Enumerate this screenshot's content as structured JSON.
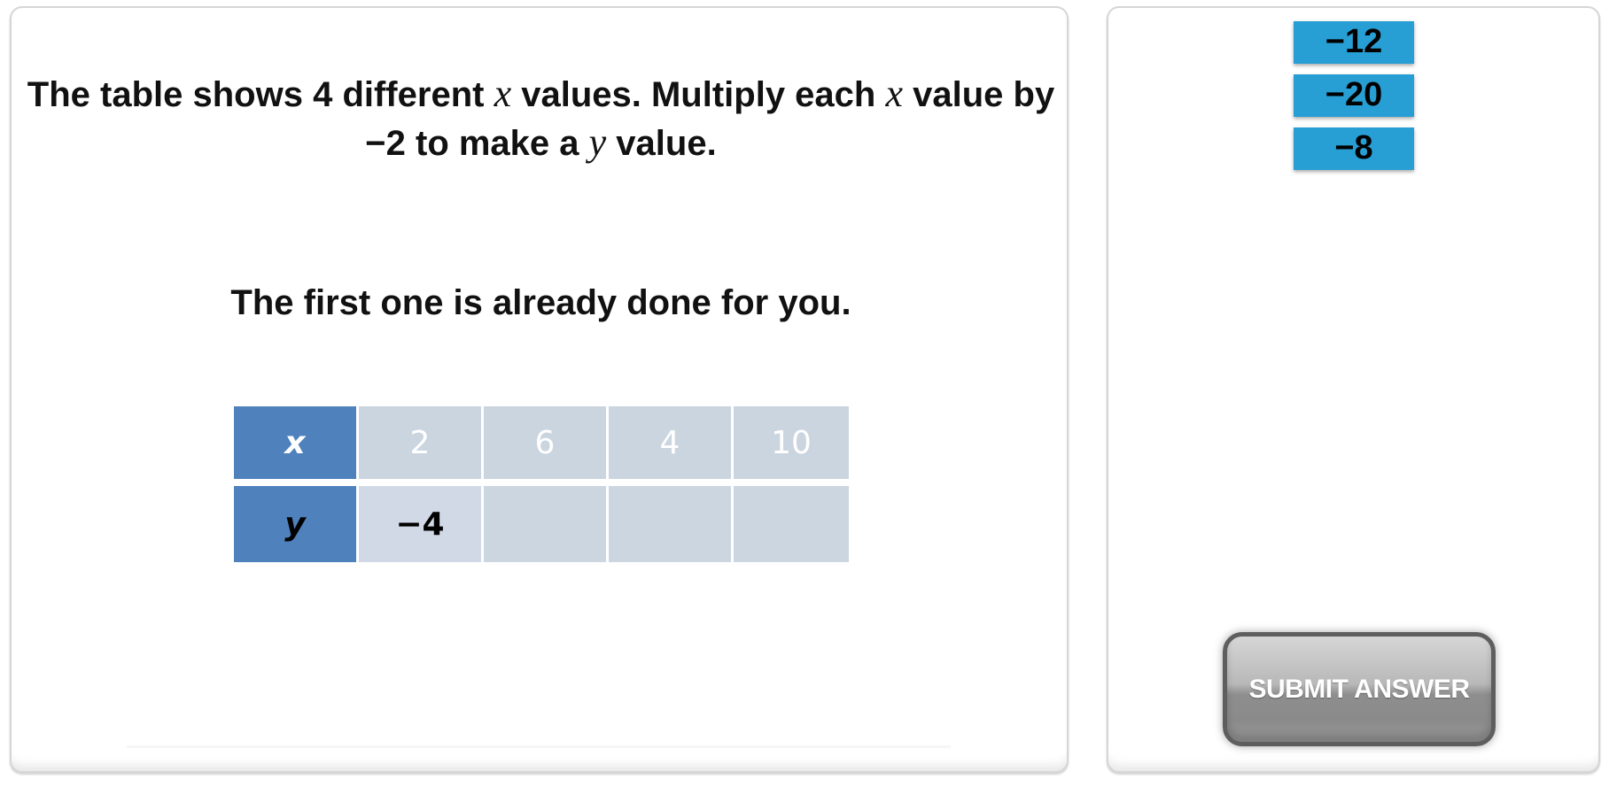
{
  "question": {
    "paragraph1": {
      "part1": "The table shows 4 different ",
      "var1": "x",
      "part2": " values. Multiply each ",
      "var2": "x",
      "part3": " value by −2 to make a ",
      "var3": "y",
      "part4": " value."
    },
    "paragraph2": "The first one is already done for you."
  },
  "table": {
    "x_label": "x",
    "y_label": "y",
    "x_values": [
      "2",
      "6",
      "4",
      "10"
    ],
    "y_values": [
      "−4",
      "",
      "",
      ""
    ]
  },
  "answer_tiles": [
    "−12",
    "−20",
    "−8"
  ],
  "colors": {
    "header_blue": "#4f81bd",
    "tile_blue": "#279fd4",
    "cell_gray": "#cbd5e0"
  },
  "submit_label": "SUBMIT ANSWER"
}
